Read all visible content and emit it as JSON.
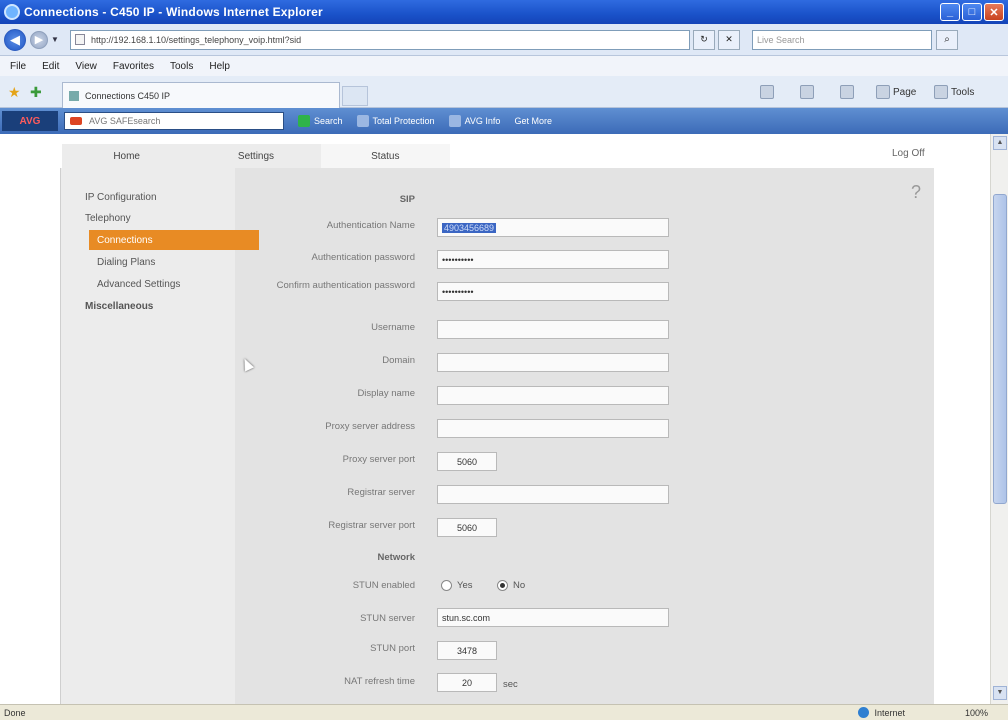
{
  "window": {
    "title": "Connections - C450 IP - Windows Internet Explorer",
    "minimize": "_",
    "maximize": "□",
    "close": "✕"
  },
  "address": {
    "url": "http://192.168.1.10/settings_telephony_voip.html?sid",
    "search_placeholder": "Live Search"
  },
  "menu": [
    "File",
    "Edit",
    "View",
    "Favorites",
    "Tools",
    "Help"
  ],
  "tab": {
    "label": "Connections C450 IP"
  },
  "commands": {
    "page": "Page",
    "tools": "Tools"
  },
  "avg": {
    "logo": "AVG",
    "search_placeholder": "AVG SAFEsearch",
    "items": [
      "Search",
      "Total Protection",
      "AVG Info",
      "Get More"
    ]
  },
  "nav": {
    "tabs": [
      "Home",
      "Settings",
      "Status"
    ],
    "logoff": "Log Off"
  },
  "sidebar": {
    "items": {
      "ip_config": "IP Configuration",
      "telephony": "Telephony",
      "connections": "Connections",
      "dialing_plans": "Dialing Plans",
      "advanced": "Advanced Settings",
      "misc": "Miscellaneous"
    }
  },
  "form": {
    "section_sip": "SIP",
    "section_network": "Network",
    "fields": {
      "auth_name": {
        "label": "Authentication Name",
        "value": "4903456689"
      },
      "auth_password": {
        "label": "Authentication password",
        "value": "••••••••••"
      },
      "confirm_password": {
        "label": "Confirm authentication password",
        "value": "••••••••••"
      },
      "username": {
        "label": "Username",
        "value": ""
      },
      "domain": {
        "label": "Domain",
        "value": ""
      },
      "display_name": {
        "label": "Display name",
        "value": ""
      },
      "proxy_address": {
        "label": "Proxy server address",
        "value": ""
      },
      "proxy_port": {
        "label": "Proxy server port",
        "value": "5060"
      },
      "registrar": {
        "label": "Registrar server",
        "value": ""
      },
      "registrar_port": {
        "label": "Registrar server port",
        "value": "5060"
      },
      "stun_enabled": {
        "label": "STUN enabled",
        "yes": "Yes",
        "no": "No",
        "selected": "No"
      },
      "stun_server": {
        "label": "STUN server",
        "value": "stun.sc.com"
      },
      "stun_port": {
        "label": "STUN port",
        "value": "3478"
      },
      "nat_refresh": {
        "label": "NAT refresh time",
        "value": "20",
        "unit": "sec"
      }
    }
  },
  "status": {
    "left": "Done",
    "zone": "Internet",
    "zoom": "100%"
  }
}
